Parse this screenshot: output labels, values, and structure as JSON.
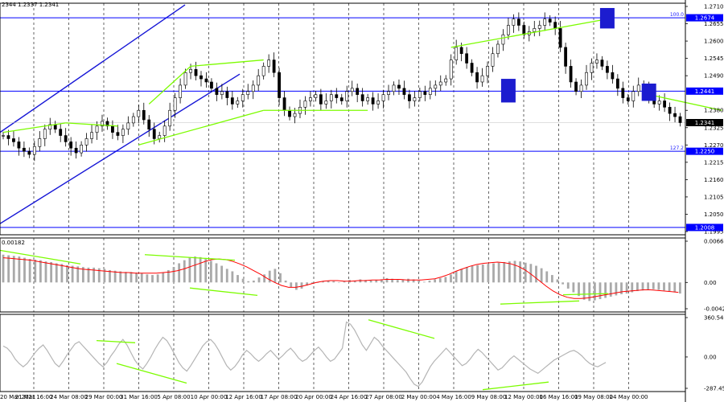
{
  "header": {
    "ohlc_text": "2344 1.2337 1.2341",
    "macd_value": "0.00182"
  },
  "colors": {
    "background": "#ffffff",
    "candle": "#000000",
    "level_line": "#0000ff",
    "channel": "#1515d6",
    "divergence": "#7cfc00",
    "marker_box": "#1c1ccf",
    "histogram": "#a9a9a9",
    "signal": "#ff0000",
    "cci": "#b4b4b4",
    "grid": "#000000"
  },
  "chart_data": [
    {
      "type": "candlestick",
      "title": "",
      "y_ticks": [
        "1.2710",
        "1.2655",
        "1.2600",
        "1.2545",
        "1.2490",
        "1.2380",
        "1.2325",
        "1.2270",
        "1.2215",
        "1.2160",
        "1.2105",
        "1.2050",
        "1.1995"
      ],
      "ylim": [
        1.1995,
        1.271
      ],
      "grid": "vertical dashed",
      "fib_levels": [
        {
          "label": "100.0",
          "value": "1.2674"
        },
        {
          "label": "",
          "value": "1.2441"
        },
        {
          "label": "127.2",
          "value": "1.2250"
        },
        {
          "label": "",
          "value": "1.2008"
        }
      ],
      "current_price": "1.2341",
      "close_series": [
        1.23,
        1.229,
        1.228,
        1.226,
        1.225,
        1.224,
        1.2265,
        1.229,
        1.232,
        1.2335,
        1.232,
        1.23,
        1.228,
        1.226,
        1.2245,
        1.227,
        1.229,
        1.231,
        1.233,
        1.2345,
        1.233,
        1.231,
        1.23,
        1.232,
        1.234,
        1.236,
        1.238,
        1.235,
        1.232,
        1.229,
        1.23,
        1.233,
        1.238,
        1.242,
        1.246,
        1.25,
        1.251,
        1.249,
        1.248,
        1.247,
        1.245,
        1.243,
        1.244,
        1.242,
        1.24,
        1.241,
        1.243,
        1.244,
        1.246,
        1.249,
        1.252,
        1.254,
        1.25,
        1.242,
        1.238,
        1.236,
        1.237,
        1.239,
        1.241,
        1.242,
        1.243,
        1.24,
        1.241,
        1.243,
        1.242,
        1.241,
        1.244,
        1.245,
        1.243,
        1.241,
        1.242,
        1.24,
        1.241,
        1.243,
        1.244,
        1.246,
        1.245,
        1.243,
        1.241,
        1.242,
        1.244,
        1.243,
        1.245,
        1.246,
        1.247,
        1.248,
        1.254,
        1.258,
        1.256,
        1.253,
        1.25,
        1.247,
        1.249,
        1.252,
        1.256,
        1.259,
        1.262,
        1.265,
        1.267,
        1.265,
        1.262,
        1.263,
        1.264,
        1.265,
        1.267,
        1.266,
        1.264,
        1.258,
        1.252,
        1.247,
        1.244,
        1.246,
        1.25,
        1.253,
        1.254,
        1.252,
        1.25,
        1.248,
        1.245,
        1.242,
        1.241,
        1.244,
        1.246,
        1.245,
        1.242,
        1.24,
        1.241,
        1.239,
        1.237,
        1.236,
        1.2341
      ],
      "markers": [
        {
          "at": 97,
          "value_high": 1.248,
          "value_low": 1.2405
        },
        {
          "at": 116,
          "value_high": 1.2705,
          "value_low": 1.264
        },
        {
          "at": 124,
          "value_high": 1.2465,
          "value_low": 1.241
        }
      ]
    },
    {
      "type": "bar",
      "title": "",
      "y_ticks": [
        "0.00668",
        "0.00",
        "-0.00426"
      ],
      "ylim": [
        -0.00426,
        0.00668
      ],
      "histogram": [
        0.0045,
        0.0044,
        0.0043,
        0.0042,
        0.004,
        0.0038,
        0.0037,
        0.0036,
        0.0034,
        0.0033,
        0.0031,
        0.003,
        0.0028,
        0.0027,
        0.0026,
        0.0025,
        0.0024,
        0.0024,
        0.0023,
        0.0022,
        0.002,
        0.0019,
        0.0018,
        0.0017,
        0.0017,
        0.0016,
        0.0015,
        0.0013,
        0.0012,
        0.0013,
        0.0016,
        0.002,
        0.0025,
        0.0031,
        0.0036,
        0.004,
        0.0042,
        0.0041,
        0.0038,
        0.0035,
        0.0031,
        0.0027,
        0.0022,
        0.0018,
        0.0012,
        0.0006,
        0.0002,
        0.0003,
        0.0008,
        0.0013,
        0.0019,
        0.0022,
        0.0015,
        0.0003,
        -0.0008,
        -0.0012,
        -0.001,
        -0.0005,
        -0.0002,
        0.0,
        0.0002,
        0.0003,
        0.0002,
        0.0,
        0.0002,
        0.0004,
        0.0003,
        0.0005,
        0.0004,
        0.0003,
        0.0004,
        0.0005,
        0.0007,
        0.0006,
        0.0004,
        0.0005,
        0.0006,
        0.0005,
        0.0003,
        0.0001,
        0.0003,
        0.0005,
        0.0007,
        0.0009,
        0.0013,
        0.0018,
        0.0022,
        0.0025,
        0.0027,
        0.0028,
        0.0029,
        0.003,
        0.0031,
        0.0032,
        0.0033,
        0.0034,
        0.0035,
        0.0034,
        0.0032,
        0.003,
        0.0027,
        0.0023,
        0.0018,
        0.0012,
        0.0005,
        -0.0003,
        -0.001,
        -0.0016,
        -0.0022,
        -0.0028,
        -0.003,
        -0.0029,
        -0.0027,
        -0.0025,
        -0.0023,
        -0.0021,
        -0.0019,
        -0.0018,
        -0.0016,
        -0.0014,
        -0.0013,
        -0.0012,
        -0.0011,
        -0.0012,
        -0.0013,
        -0.0014,
        -0.0016,
        -0.0018
      ],
      "signal": [
        0.004,
        0.0039,
        0.0038,
        0.0037,
        0.0036,
        0.0034,
        0.0032,
        0.003,
        0.0028,
        0.0026,
        0.0024,
        0.0022,
        0.0021,
        0.002,
        0.0019,
        0.0018,
        0.0017,
        0.0016,
        0.0016,
        0.0015,
        0.0015,
        0.0015,
        0.0015,
        0.0016,
        0.0017,
        0.0019,
        0.0022,
        0.0026,
        0.003,
        0.0034,
        0.0037,
        0.0038,
        0.0037,
        0.0034,
        0.003,
        0.0025,
        0.0019,
        0.0013,
        0.0006,
        0.0,
        -0.0005,
        -0.0008,
        -0.0008,
        -0.0006,
        -0.0003,
        0.0,
        0.0002,
        0.0003,
        0.0003,
        0.0002,
        0.0002,
        0.0003,
        0.0003,
        0.0004,
        0.0004,
        0.0005,
        0.0005,
        0.0005,
        0.0004,
        0.0004,
        0.0004,
        0.0005,
        0.0006,
        0.0009,
        0.0013,
        0.0018,
        0.0022,
        0.0026,
        0.0029,
        0.0031,
        0.0032,
        0.0033,
        0.0032,
        0.003,
        0.0026,
        0.002,
        0.0012,
        0.0003,
        -0.0006,
        -0.0014,
        -0.002,
        -0.0024,
        -0.0026,
        -0.0026,
        -0.0025,
        -0.0023,
        -0.0021,
        -0.0019,
        -0.0017,
        -0.0015,
        -0.0014,
        -0.0013,
        -0.0012,
        -0.0012,
        -0.0013,
        -0.0014,
        -0.0015,
        -0.0016
      ]
    },
    {
      "type": "line",
      "title": "",
      "y_ticks": [
        "360.5402",
        "0.00",
        "-287.457"
      ],
      "ylim": [
        -287.457,
        360.5402
      ],
      "cci": [
        100,
        80,
        40,
        -20,
        -60,
        -90,
        -60,
        -10,
        40,
        80,
        110,
        60,
        0,
        -60,
        -90,
        -40,
        20,
        70,
        120,
        140,
        100,
        60,
        20,
        -20,
        -60,
        -90,
        -50,
        10,
        60,
        120,
        160,
        110,
        40,
        -30,
        -80,
        -110,
        -60,
        0,
        70,
        130,
        180,
        150,
        90,
        20,
        -50,
        -100,
        -130,
        -80,
        -20,
        40,
        100,
        140,
        160,
        120,
        60,
        -10,
        -80,
        -120,
        -90,
        -40,
        20,
        60,
        30,
        -10,
        -40,
        -10,
        30,
        60,
        20,
        -20,
        10,
        50,
        80,
        40,
        -10,
        -40,
        -20,
        20,
        60,
        90,
        50,
        0,
        -40,
        -20,
        30,
        80,
        320,
        300,
        250,
        180,
        110,
        60,
        120,
        180,
        150,
        100,
        60,
        20,
        -20,
        -60,
        -100,
        -140,
        -200,
        -250,
        -270,
        -230,
        -160,
        -90,
        -40,
        0,
        40,
        80,
        40,
        0,
        -40,
        -80,
        -60,
        -20,
        30,
        70,
        40,
        0,
        -40,
        -80,
        -120,
        -100,
        -60,
        -20,
        10,
        -20,
        -50,
        -80,
        -110,
        -130,
        -150,
        -120,
        -90,
        -60,
        -30,
        -10,
        10,
        30,
        50,
        60,
        40,
        10,
        -30,
        -60,
        -80,
        -90,
        -70,
        -50
      ]
    }
  ],
  "date_labels": [
    "20 Mar 2021",
    "21 Mar 16:00",
    "24 Mar 08:00",
    "29 Mar 00:00",
    "31 Mar 16:00",
    "5 Apr 08:00",
    "10 Apr 00:00",
    "12 Apr 16:00",
    "17 Apr 08:00",
    "20 Apr 00:00",
    "24 Apr 16:00",
    "27 Apr 08:00",
    "2 May 00:00",
    "4 May 16:00",
    "9 May 08:00",
    "12 May 00:00",
    "16 May 16:00",
    "19 May 08:00",
    "24 May 00:00"
  ]
}
